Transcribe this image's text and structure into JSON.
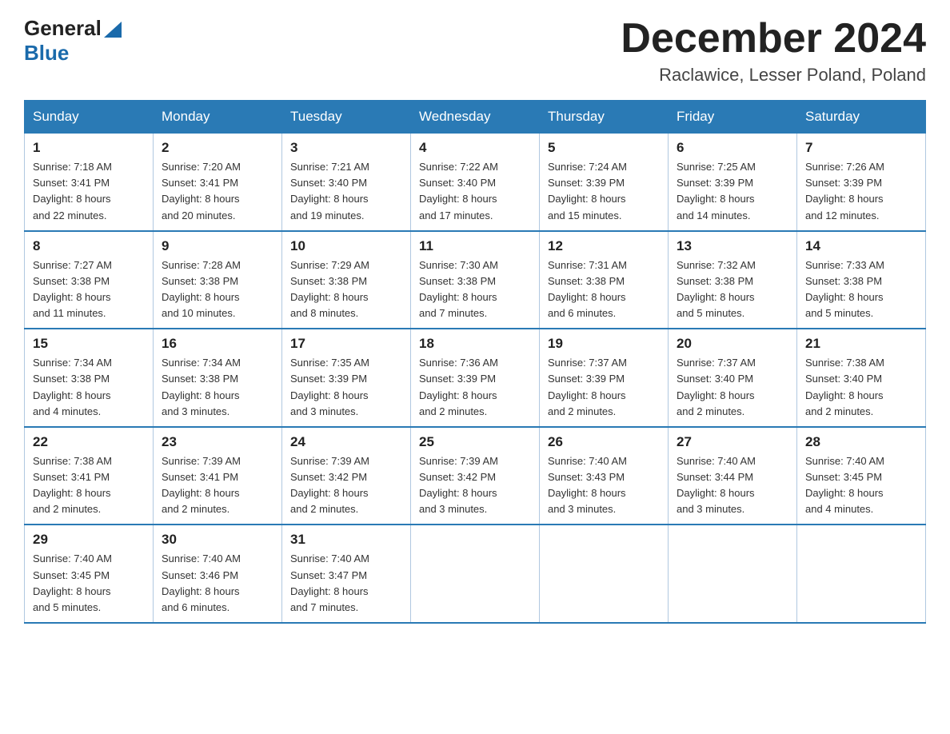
{
  "logo": {
    "text_general": "General",
    "text_blue": "Blue",
    "arrow": "▶"
  },
  "title": "December 2024",
  "location": "Raclawice, Lesser Poland, Poland",
  "headers": [
    "Sunday",
    "Monday",
    "Tuesday",
    "Wednesday",
    "Thursday",
    "Friday",
    "Saturday"
  ],
  "weeks": [
    [
      {
        "day": "1",
        "sunrise": "7:18 AM",
        "sunset": "3:41 PM",
        "daylight": "8 hours and 22 minutes."
      },
      {
        "day": "2",
        "sunrise": "7:20 AM",
        "sunset": "3:41 PM",
        "daylight": "8 hours and 20 minutes."
      },
      {
        "day": "3",
        "sunrise": "7:21 AM",
        "sunset": "3:40 PM",
        "daylight": "8 hours and 19 minutes."
      },
      {
        "day": "4",
        "sunrise": "7:22 AM",
        "sunset": "3:40 PM",
        "daylight": "8 hours and 17 minutes."
      },
      {
        "day": "5",
        "sunrise": "7:24 AM",
        "sunset": "3:39 PM",
        "daylight": "8 hours and 15 minutes."
      },
      {
        "day": "6",
        "sunrise": "7:25 AM",
        "sunset": "3:39 PM",
        "daylight": "8 hours and 14 minutes."
      },
      {
        "day": "7",
        "sunrise": "7:26 AM",
        "sunset": "3:39 PM",
        "daylight": "8 hours and 12 minutes."
      }
    ],
    [
      {
        "day": "8",
        "sunrise": "7:27 AM",
        "sunset": "3:38 PM",
        "daylight": "8 hours and 11 minutes."
      },
      {
        "day": "9",
        "sunrise": "7:28 AM",
        "sunset": "3:38 PM",
        "daylight": "8 hours and 10 minutes."
      },
      {
        "day": "10",
        "sunrise": "7:29 AM",
        "sunset": "3:38 PM",
        "daylight": "8 hours and 8 minutes."
      },
      {
        "day": "11",
        "sunrise": "7:30 AM",
        "sunset": "3:38 PM",
        "daylight": "8 hours and 7 minutes."
      },
      {
        "day": "12",
        "sunrise": "7:31 AM",
        "sunset": "3:38 PM",
        "daylight": "8 hours and 6 minutes."
      },
      {
        "day": "13",
        "sunrise": "7:32 AM",
        "sunset": "3:38 PM",
        "daylight": "8 hours and 5 minutes."
      },
      {
        "day": "14",
        "sunrise": "7:33 AM",
        "sunset": "3:38 PM",
        "daylight": "8 hours and 5 minutes."
      }
    ],
    [
      {
        "day": "15",
        "sunrise": "7:34 AM",
        "sunset": "3:38 PM",
        "daylight": "8 hours and 4 minutes."
      },
      {
        "day": "16",
        "sunrise": "7:34 AM",
        "sunset": "3:38 PM",
        "daylight": "8 hours and 3 minutes."
      },
      {
        "day": "17",
        "sunrise": "7:35 AM",
        "sunset": "3:39 PM",
        "daylight": "8 hours and 3 minutes."
      },
      {
        "day": "18",
        "sunrise": "7:36 AM",
        "sunset": "3:39 PM",
        "daylight": "8 hours and 2 minutes."
      },
      {
        "day": "19",
        "sunrise": "7:37 AM",
        "sunset": "3:39 PM",
        "daylight": "8 hours and 2 minutes."
      },
      {
        "day": "20",
        "sunrise": "7:37 AM",
        "sunset": "3:40 PM",
        "daylight": "8 hours and 2 minutes."
      },
      {
        "day": "21",
        "sunrise": "7:38 AM",
        "sunset": "3:40 PM",
        "daylight": "8 hours and 2 minutes."
      }
    ],
    [
      {
        "day": "22",
        "sunrise": "7:38 AM",
        "sunset": "3:41 PM",
        "daylight": "8 hours and 2 minutes."
      },
      {
        "day": "23",
        "sunrise": "7:39 AM",
        "sunset": "3:41 PM",
        "daylight": "8 hours and 2 minutes."
      },
      {
        "day": "24",
        "sunrise": "7:39 AM",
        "sunset": "3:42 PM",
        "daylight": "8 hours and 2 minutes."
      },
      {
        "day": "25",
        "sunrise": "7:39 AM",
        "sunset": "3:42 PM",
        "daylight": "8 hours and 3 minutes."
      },
      {
        "day": "26",
        "sunrise": "7:40 AM",
        "sunset": "3:43 PM",
        "daylight": "8 hours and 3 minutes."
      },
      {
        "day": "27",
        "sunrise": "7:40 AM",
        "sunset": "3:44 PM",
        "daylight": "8 hours and 3 minutes."
      },
      {
        "day": "28",
        "sunrise": "7:40 AM",
        "sunset": "3:45 PM",
        "daylight": "8 hours and 4 minutes."
      }
    ],
    [
      {
        "day": "29",
        "sunrise": "7:40 AM",
        "sunset": "3:45 PM",
        "daylight": "8 hours and 5 minutes."
      },
      {
        "day": "30",
        "sunrise": "7:40 AM",
        "sunset": "3:46 PM",
        "daylight": "8 hours and 6 minutes."
      },
      {
        "day": "31",
        "sunrise": "7:40 AM",
        "sunset": "3:47 PM",
        "daylight": "8 hours and 7 minutes."
      },
      null,
      null,
      null,
      null
    ]
  ],
  "labels": {
    "sunrise": "Sunrise: ",
    "sunset": "Sunset: ",
    "daylight": "Daylight: "
  }
}
